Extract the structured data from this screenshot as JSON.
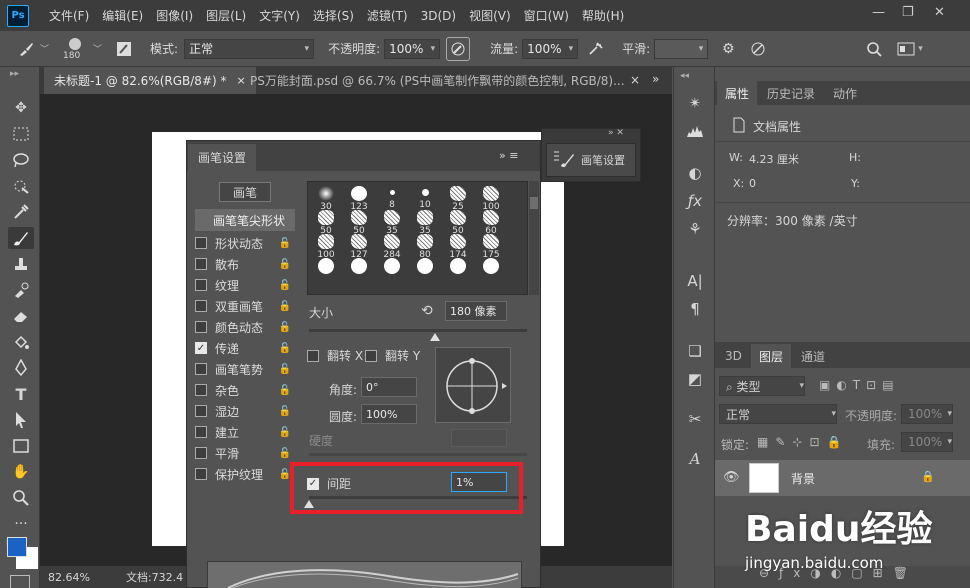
{
  "app": {
    "logo": "Ps"
  },
  "menu": [
    "文件(F)",
    "编辑(E)",
    "图像(I)",
    "图层(L)",
    "文字(Y)",
    "选择(S)",
    "滤镜(T)",
    "3D(D)",
    "视图(V)",
    "窗口(W)",
    "帮助(H)"
  ],
  "window_controls": {
    "minimize": "—",
    "restore": "❐",
    "close": "✕"
  },
  "options": {
    "brush_size": "180",
    "mode_label": "模式:",
    "mode_value": "正常",
    "opacity_label": "不透明度:",
    "opacity_value": "100%",
    "flow_label": "流量:",
    "flow_value": "100%",
    "smooth_label": "平滑:",
    "smooth_value": ""
  },
  "tabs": [
    {
      "label": "未标题-1 @ 82.6%(RGB/8#) *",
      "close": "×"
    },
    {
      "label": "PS万能封面.psd @ 66.7% (PS中画笔制作飘带的颜色控制, RGB/8)...",
      "close": "×"
    }
  ],
  "tabs_more": "»",
  "status": {
    "zoom": "82.64%",
    "doc": "文档:732.4"
  },
  "brush_panel": {
    "title": "画笔设置",
    "header_controls": "»  ≡",
    "brushes_button": "画笔",
    "tip_shape_label": "画笔笔尖形状",
    "options": [
      {
        "label": "形状动态",
        "checked": false
      },
      {
        "label": "散布",
        "checked": false
      },
      {
        "label": "纹理",
        "checked": false
      },
      {
        "label": "双重画笔",
        "checked": false
      },
      {
        "label": "颜色动态",
        "checked": false
      },
      {
        "label": "传递",
        "checked": true
      },
      {
        "label": "画笔笔势",
        "checked": false
      },
      {
        "label": "杂色",
        "checked": false
      },
      {
        "label": "湿边",
        "checked": false
      },
      {
        "label": "建立",
        "checked": false
      },
      {
        "label": "平滑",
        "checked": false
      },
      {
        "label": "保护纹理",
        "checked": false
      }
    ],
    "tip_sizes": [
      "30",
      "123",
      "8",
      "10",
      "25",
      "100",
      "50",
      "50",
      "35",
      "35",
      "50",
      "60",
      "100",
      "127",
      "284",
      "80",
      "174",
      "175",
      "",
      "",
      "",
      "",
      "",
      ""
    ],
    "size_label": "大小",
    "size_value": "180 像素",
    "size_level": 0.58,
    "flip_x_label": "翻转 X",
    "flip_y_label": "翻转 Y",
    "angle_label": "角度:",
    "angle_value": "0°",
    "roundness_label": "圆度:",
    "roundness_value": "100%",
    "hardness_label": "硬度",
    "spacing_label": "间距",
    "spacing_checked": true,
    "spacing_value": "1%"
  },
  "mini_panel": {
    "label": "画笔设置",
    "controls": "»  ✕"
  },
  "properties": {
    "tabs": [
      "属性",
      "历史记录",
      "动作"
    ],
    "doc_title": "文档属性",
    "w_label": "W:",
    "w_value": "4.23 厘米",
    "h_label": "H:",
    "x_label": "X:",
    "x_value": "0",
    "y_label": "Y:",
    "resolution": "分辨率：300 像素 /英寸"
  },
  "layers": {
    "tabs": [
      "3D",
      "图层",
      "通道"
    ],
    "kind_label": "类型",
    "blend_mode": "正常",
    "opacity_label": "不透明度:",
    "opacity_value": "100%",
    "lock_label": "锁定:",
    "fill_label": "填充:",
    "fill_value": "100%",
    "layer_name": "背景"
  },
  "watermark": {
    "text": "Baidu经验",
    "url": "jingyan.baidu.com"
  },
  "colors": {
    "accent": "#31a8ff",
    "highlight_red": "#e8202a",
    "foreground": "#1a62c4",
    "background": "#ffffff"
  }
}
